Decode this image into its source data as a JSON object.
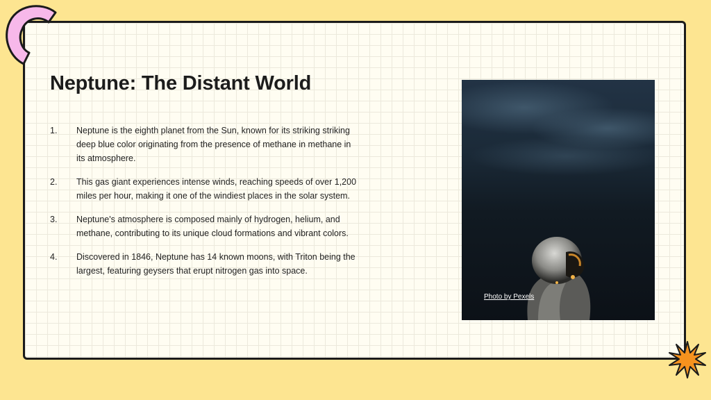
{
  "slide": {
    "title": "Neptune: The Distant World",
    "items": [
      {
        "number": "1.",
        "text": "Neptune is the eighth planet from the Sun, known for its striking striking deep blue color originating from the presence of methane in methane in its atmosphere."
      },
      {
        "number": "2.",
        "text": "This gas giant experiences intense winds, reaching speeds of over 1,200 miles per hour, making it one of the windiest places in the solar system."
      },
      {
        "number": "3.",
        "text": "Neptune's atmosphere is composed mainly of hydrogen, helium, and methane, contributing to its unique cloud formations and vibrant colors."
      },
      {
        "number": "4.",
        "text": "Discovered in 1846, Neptune has 14 known moons, with Triton being the largest, featuring geysers that erupt nitrogen gas into space."
      }
    ],
    "photo": {
      "credit": "Photo by Pexels",
      "subject": "astronaut-in-dark-sky"
    }
  },
  "colors": {
    "background": "#fde591",
    "card": "#fffdf2",
    "border": "#1b1b1b",
    "deco_pink": "#f7b8ea",
    "deco_orange": "#f6921e"
  }
}
